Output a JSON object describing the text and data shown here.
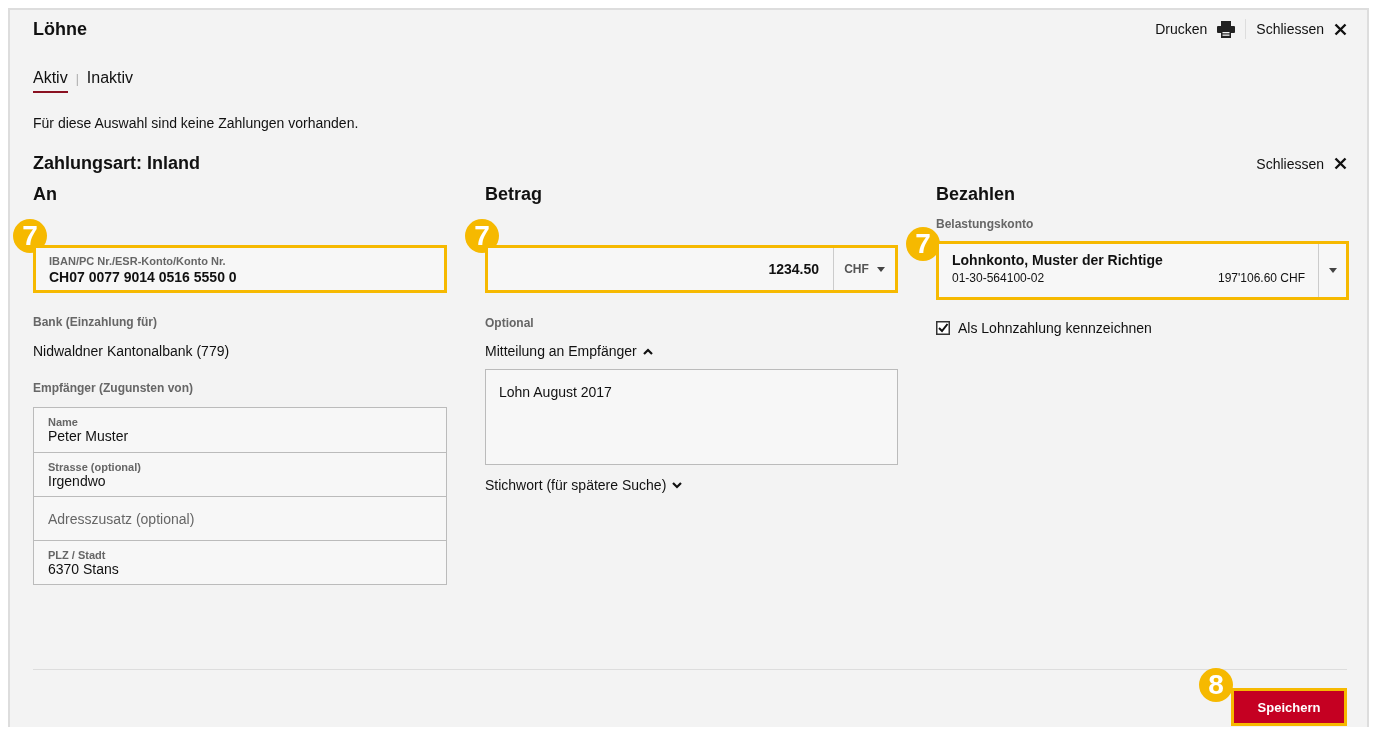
{
  "header": {
    "title": "Löhne",
    "actions": [
      {
        "label": "Drucken"
      },
      {
        "label": "Schliessen"
      }
    ]
  },
  "tabs": [
    {
      "label": "Aktiv",
      "selected": true
    },
    {
      "label": "Inaktiv",
      "selected": false
    }
  ],
  "tab_separator": "|",
  "message": "Für diese Auswahl sind keine Zahlungen vorhanden.",
  "payment": {
    "title": "Zahlungsart: Inland",
    "close_label": "Schliessen",
    "recipient": {
      "heading": "An",
      "account_field": {
        "label": "IBAN/PC Nr./ESR-Konto/Konto Nr.",
        "value": "CH07 0077 9014 0516 5550 0",
        "callout": "7"
      },
      "bank_label": "Bank (Einzahlung für)",
      "bank_value": "Nidwaldner Kantonalbank (779)",
      "payee_label": "Empfänger (Zugunsten von)",
      "payee_fields": [
        {
          "label": "Name",
          "value": "Peter Muster"
        },
        {
          "label": "Strasse (optional)",
          "value": "Irgendwo"
        },
        {
          "placeholder": "Adresszusatz (optional)"
        },
        {
          "label": "PLZ / Stadt",
          "value": "6370 Stans"
        }
      ]
    },
    "amount": {
      "heading": "Betrag",
      "value": "1234.50",
      "currency": "CHF",
      "callout": "7",
      "optional_label": "Optional",
      "message_toggle": {
        "label": "Mitteilung an Empfänger",
        "expanded": true
      },
      "message_value": "Lohn August 2017",
      "keyword_toggle": {
        "label": "Stichwort (für spätere Suche)",
        "expanded": false
      }
    },
    "debit": {
      "heading": "Bezahlen",
      "account_label": "Belastungskonto",
      "account_name": "Lohnkonto, Muster der Richtige",
      "account_number": "01-30-564100-02",
      "balance": "197'106.60 CHF",
      "callout": "7",
      "salary_checkbox": {
        "label": "Als Lohnzahlung kennzeichnen",
        "checked": true
      }
    }
  },
  "save_button": {
    "label": "Speichern",
    "callout": "8"
  }
}
